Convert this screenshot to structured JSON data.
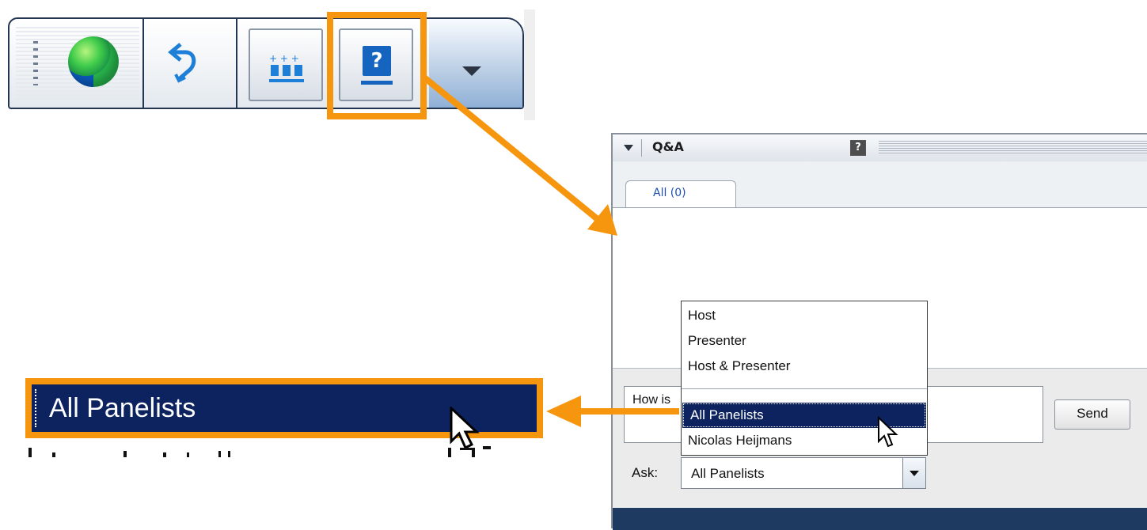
{
  "toolbar": {
    "icons": [
      "grip-icon",
      "globe-icon",
      "undo-arrow-icon",
      "attendees-icon",
      "qa-question-icon",
      "chevron-down-icon"
    ],
    "help_glyph": "?"
  },
  "zoom_callout": {
    "label": "All Panelists"
  },
  "qa_panel": {
    "title": "Q&A",
    "help_glyph": "?",
    "tab_label": "All (0)",
    "question_text": "How is",
    "send_label": "Send",
    "ask_label": "Ask:",
    "ask_value": "All Panelists",
    "dropdown_options": [
      "Host",
      "Presenter",
      "Host & Presenter"
    ],
    "dropdown_selected": "All Panelists",
    "dropdown_after": "Nicolas Heijmans"
  },
  "colors": {
    "highlight": "#f6960f",
    "selection": "#0c2360",
    "link_blue": "#1f4fae"
  }
}
